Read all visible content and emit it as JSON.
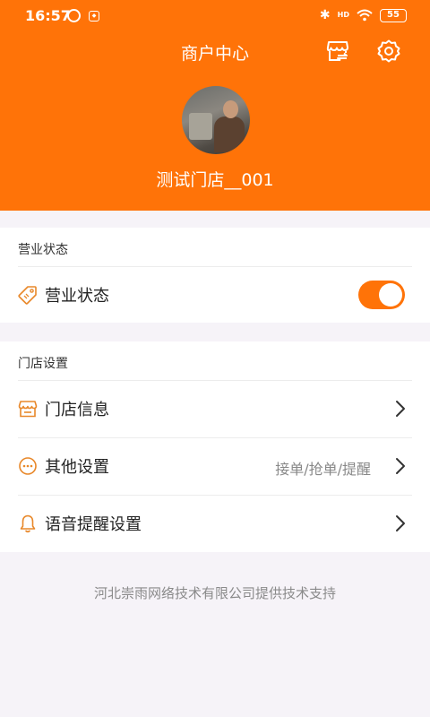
{
  "statusbar": {
    "time": "16:57",
    "signal": "HD",
    "battery": "55"
  },
  "header": {
    "title": "商户中心",
    "shop_name": "测试门店__001"
  },
  "sections": {
    "business": {
      "title": "营业状态",
      "row_label": "营业状态",
      "toggle_on": true
    },
    "store": {
      "title": "门店设置",
      "rows": [
        {
          "label": "门店信息",
          "hint": ""
        },
        {
          "label": "其他设置",
          "hint": "接单/抢单/提醒"
        },
        {
          "label": "语音提醒设置",
          "hint": ""
        }
      ]
    }
  },
  "footer": {
    "text": "河北崇雨网络技术有限公司提供技术支持"
  },
  "colors": {
    "accent": "#ff7308",
    "background": "#f6f3f8"
  }
}
